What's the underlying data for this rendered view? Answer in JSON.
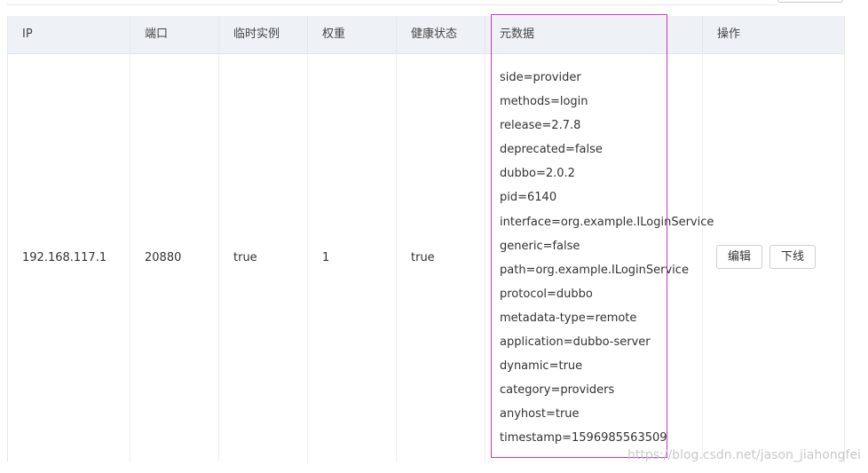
{
  "table": {
    "headers": {
      "ip": "IP",
      "port": "端口",
      "ephemeral": "临时实例",
      "weight": "权重",
      "health": "健康状态",
      "metadata": "元数据",
      "actions": "操作"
    },
    "row": {
      "ip": "192.168.117.1",
      "port": "20880",
      "ephemeral": "true",
      "weight": "1",
      "health": "true",
      "metadata": [
        "side=provider",
        "methods=login",
        "release=2.7.8",
        "deprecated=false",
        "dubbo=2.0.2",
        "pid=6140",
        "interface=org.example.ILoginService",
        "generic=false",
        "path=org.example.ILoginService",
        "protocol=dubbo",
        "metadata-type=remote",
        "application=dubbo-server",
        "dynamic=true",
        "category=providers",
        "anyhost=true",
        "timestamp=1596985563509"
      ],
      "edit_label": "编辑",
      "offline_label": "下线"
    }
  },
  "watermark": "https://blog.csdn.net/jason_jiahongfei",
  "colors": {
    "header_bg": "#eef1f6",
    "highlight_border": "#cc33cc"
  }
}
